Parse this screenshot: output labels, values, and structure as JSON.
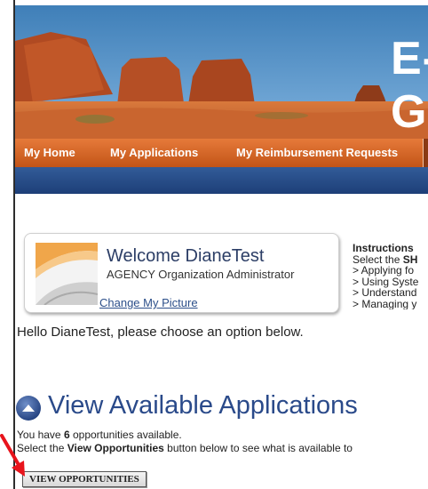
{
  "banner": {
    "title": "E-G"
  },
  "nav": {
    "items": [
      {
        "label": "My Home"
      },
      {
        "label": "My Applications"
      },
      {
        "label": "My Reimbursement Requests"
      }
    ]
  },
  "welcome": {
    "greeting": "Welcome DianeTest",
    "role": "AGENCY Organization Administrator",
    "change_picture": "Change My Picture"
  },
  "instructions": {
    "heading": "Instructions",
    "select_prefix": "Select the ",
    "select_bold": "SH",
    "items": [
      "> Applying fo",
      "> Using Syste",
      "> Understand",
      "> Managing y"
    ]
  },
  "hello": "Hello DianeTest, please choose an option below.",
  "applications": {
    "title": "View Available Applications",
    "count_prefix": "You have ",
    "count": "6",
    "count_suffix": " opportunities available.",
    "select_prefix": "Select the ",
    "select_bold": "View Opportunities",
    "select_suffix": " button below to see what is available to",
    "button_label": "VIEW OPPORTUNITIES"
  },
  "colors": {
    "nav_orange": "#e67a3a",
    "nav_blue": "#1d3f78",
    "title_blue": "#2a4a8a",
    "arrow_red": "#e8141c"
  }
}
